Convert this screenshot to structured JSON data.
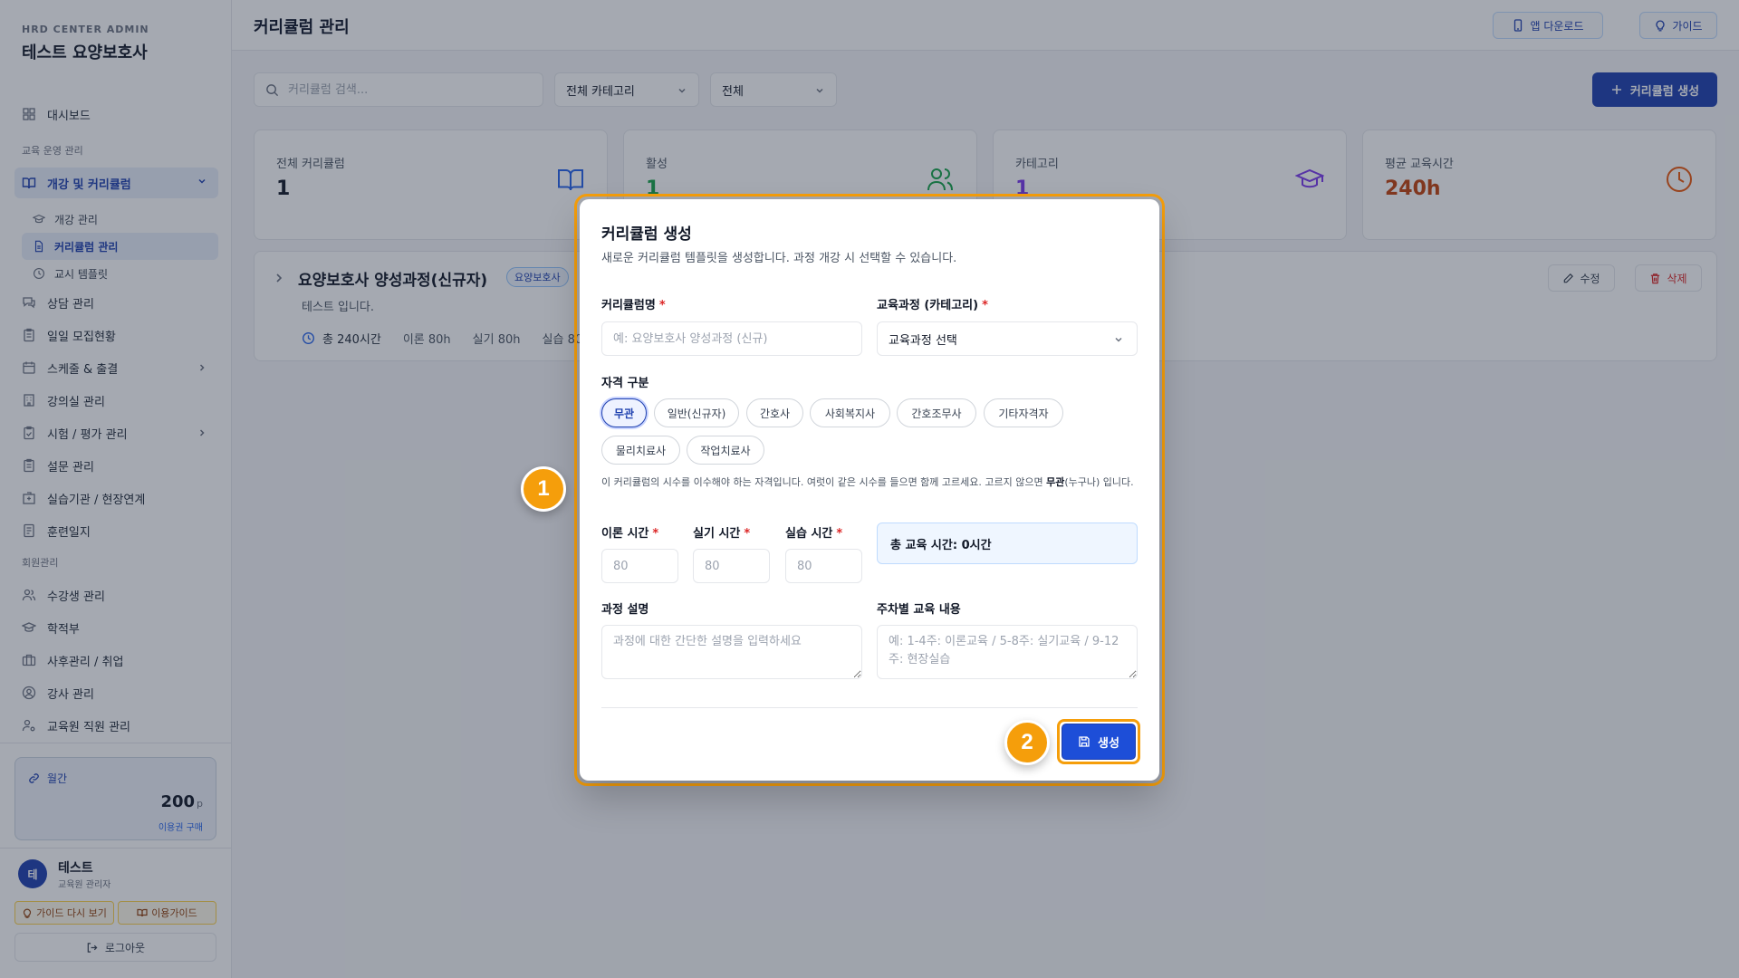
{
  "sidebar": {
    "brand_sub": "HRD CENTER ADMIN",
    "brand_title": "테스트 요양보호사",
    "dashboard": "대시보드",
    "section_edu": "교육 운영 관리",
    "course_group": "개강 및 커리큘럼",
    "sub_items": [
      "개강 관리",
      "커리큘럼 관리",
      "교시 템플릿"
    ],
    "edu_items": [
      "상담 관리",
      "일일 모집현황",
      "스케줄 & 출결",
      "강의실 관리",
      "시험 / 평가 관리",
      "설문 관리",
      "실습기관 / 현장연계",
      "훈련일지"
    ],
    "section_member": "회원관리",
    "member_items": [
      "수강생 관리",
      "학적부",
      "사후관리 / 취업",
      "강사 관리",
      "교육원 직원 관리"
    ],
    "points": {
      "label": "월간",
      "value": "200",
      "unit": "p",
      "link": "이용권 구매"
    },
    "user": {
      "initial": "테",
      "name": "테스트",
      "role": "교육원 관리자"
    },
    "guide_again": "가이드 다시 보기",
    "usage_guide": "이용가이드",
    "logout": "로그아웃"
  },
  "header": {
    "title": "커리큘럼 관리",
    "app_download": "앱 다운로드",
    "guide": "가이드"
  },
  "toolbar": {
    "search_placeholder": "커리큘럼 검색...",
    "category_select": "전체 카테고리",
    "status_select": "전체",
    "create_label": "커리큘럼 생성"
  },
  "stats": [
    {
      "label": "전체 커리큘럼",
      "value": "1",
      "color": "#111827",
      "icon_color": "#2563eb"
    },
    {
      "label": "활성",
      "value": "1",
      "color": "#16a34a",
      "icon_color": "#16a34a"
    },
    {
      "label": "카테고리",
      "value": "1",
      "color": "#7c3aed",
      "icon_color": "#7c3aed"
    },
    {
      "label": "평균 교육시간",
      "value": "240h",
      "color": "#c2410c",
      "icon_color": "#ea580c"
    }
  ],
  "curriculum": {
    "title": "요양보호사 양성과정(신규자)",
    "badge": "요양보호사",
    "desc": "테스트 입니다.",
    "total": "총 240시간",
    "theory": "이론 80h",
    "practice": "실기 80h",
    "training": "실습 80h",
    "edit": "수정",
    "delete": "삭제"
  },
  "modal": {
    "title": "커리큘럼 생성",
    "desc": "새로운 커리큘럼 템플릿을 생성합니다. 과정 개강 시 선택할 수 있습니다.",
    "name_label": "커리큘럼명",
    "name_placeholder": "예: 요양보호사 양성과정 (신규)",
    "category_label": "교육과정 (카테고리)",
    "category_value": "교육과정 선택",
    "req_mark": "*",
    "qual_label": "자격 구분",
    "chips": [
      "무관",
      "일반(신규자)",
      "간호사",
      "사회복지사",
      "간호조무사",
      "기타자격자",
      "물리치료사",
      "작업치료사"
    ],
    "hint_pre": "이 커리큘럼의 시수를 이수해야 하는 자격입니다. 여럿이 같은 시수를 들으면 함께 고르세요. 고르지 않으면 ",
    "hint_bold": "무관",
    "hint_post": "(누구나) 입니다.",
    "theory_label": "이론 시간",
    "practice_label": "실기 시간",
    "training_label": "실습 시간",
    "hours_placeholder": "80",
    "total_text": "총 교육 시간: 0시간",
    "course_desc_label": "과정 설명",
    "course_desc_placeholder": "과정에 대한 간단한 설명을 입력하세요",
    "weekly_label": "주차별 교육 내용",
    "weekly_placeholder": "예: 1-4주: 이론교육 / 5-8주: 실기교육 / 9-12주: 현장실습",
    "submit": "생성"
  },
  "markers": [
    "1",
    "2"
  ],
  "colors": {
    "accent": "#1e40af",
    "highlight": "#f59e0b"
  }
}
